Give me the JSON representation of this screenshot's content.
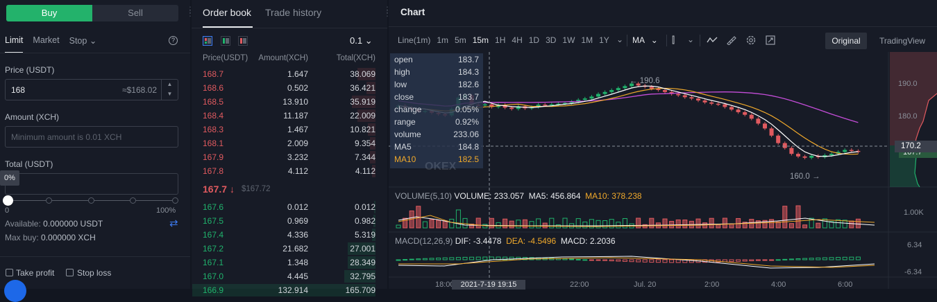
{
  "trade": {
    "buy_label": "Buy",
    "sell_label": "Sell",
    "order_tabs": [
      "Limit",
      "Market",
      "Stop"
    ],
    "price_label": "Price (USDT)",
    "price_value": "168",
    "price_usd": "≈$168.02",
    "amount_label": "Amount (XCH)",
    "amount_placeholder": "Minimum amount is 0.01 XCH",
    "total_label": "Total (USDT)",
    "slider_percent": "0%",
    "slider_min": "0",
    "slider_max": "100%",
    "available_label": "Available:",
    "available_value": "0.000000 USDT",
    "maxbuy_label": "Max buy:",
    "maxbuy_value": "0.000000 XCH",
    "take_profit_label": "Take profit",
    "stop_loss_label": "Stop loss"
  },
  "book": {
    "tab_orderbook": "Order book",
    "tab_history": "Trade history",
    "precision": "0.1",
    "col_price": "Price(USDT)",
    "col_amount": "Amount(XCH)",
    "col_total": "Total(XCH)",
    "asks": [
      {
        "price": "168.7",
        "amount": "1.647",
        "total": "38.069",
        "depth": 0.1
      },
      {
        "price": "168.6",
        "amount": "0.502",
        "total": "36.421",
        "depth": 0.05
      },
      {
        "price": "168.5",
        "amount": "13.910",
        "total": "35.919",
        "depth": 0.13
      },
      {
        "price": "168.4",
        "amount": "11.187",
        "total": "22.009",
        "depth": 0.1
      },
      {
        "price": "168.3",
        "amount": "1.467",
        "total": "10.821",
        "depth": 0.04
      },
      {
        "price": "168.1",
        "amount": "2.009",
        "total": "9.354",
        "depth": 0.03
      },
      {
        "price": "167.9",
        "amount": "3.232",
        "total": "7.344",
        "depth": 0.03
      },
      {
        "price": "167.8",
        "amount": "4.112",
        "total": "4.112",
        "depth": 0.02
      }
    ],
    "last_price": "167.7",
    "last_arrow": "↓",
    "last_usd": "$167.72",
    "bids": [
      {
        "price": "167.6",
        "amount": "0.012",
        "total": "0.012",
        "depth": 0.0
      },
      {
        "price": "167.5",
        "amount": "0.969",
        "total": "0.982",
        "depth": 0.01
      },
      {
        "price": "167.4",
        "amount": "4.336",
        "total": "5.319",
        "depth": 0.02
      },
      {
        "price": "167.2",
        "amount": "21.682",
        "total": "27.001",
        "depth": 0.15
      },
      {
        "price": "167.1",
        "amount": "1.348",
        "total": "28.349",
        "depth": 0.15
      },
      {
        "price": "167.0",
        "amount": "4.445",
        "total": "32.795",
        "depth": 0.17
      },
      {
        "price": "166.9",
        "amount": "132.914",
        "total": "165.709",
        "depth": 1.0
      }
    ]
  },
  "chart": {
    "title": "Chart",
    "timeframes": [
      "Line(1m)",
      "1m",
      "5m",
      "15m",
      "1H",
      "4H",
      "1D",
      "3D",
      "1W",
      "1M",
      "1Y"
    ],
    "active_timeframe": "15m",
    "indicator": "MA",
    "view_original": "Original",
    "view_tradingview": "TradingView",
    "info": [
      {
        "k": "open",
        "v": "183.7"
      },
      {
        "k": "high",
        "v": "184.3"
      },
      {
        "k": "low",
        "v": "182.6"
      },
      {
        "k": "close",
        "v": "183.7"
      },
      {
        "k": "change",
        "v": "0.05%"
      },
      {
        "k": "range",
        "v": "0.92%"
      },
      {
        "k": "volume",
        "v": "233.06"
      },
      {
        "k": "MA5",
        "v": "184.8"
      },
      {
        "k": "MA10",
        "v": "182.5"
      }
    ],
    "watermark": "OKEX",
    "high_marker": "← 190.6",
    "low_marker": "160.0 →",
    "price_ticks": [
      "190.0",
      "180.0"
    ],
    "cross_price": "170.2",
    "last_tag": "167.7",
    "volume_legend": {
      "label": "VOLUME(5,10)",
      "vol": "VOLUME: 233.057",
      "ma5": "MA5: 456.864",
      "ma10": "MA10: 378.238"
    },
    "volume_tick": "1.00K",
    "macd_legend": {
      "label": "MACD(12,26,9)",
      "dif": "DIF: -3.4478",
      "dea": "DEA: -4.5496",
      "macd": "MACD: 2.2036"
    },
    "macd_ticks": [
      "6.34",
      "-6.34"
    ],
    "time_ticks": [
      "18:00",
      "22:00",
      "Jul. 20",
      "2:00",
      "4:00",
      "6:00"
    ],
    "cross_time": "2021-7-19 19:15",
    "colors": {
      "up": "#20b26c",
      "down": "#e05a5f",
      "ma5": "#ffffff",
      "ma10": "#f0a92b",
      "ma_long": "#c44dd8"
    }
  }
}
